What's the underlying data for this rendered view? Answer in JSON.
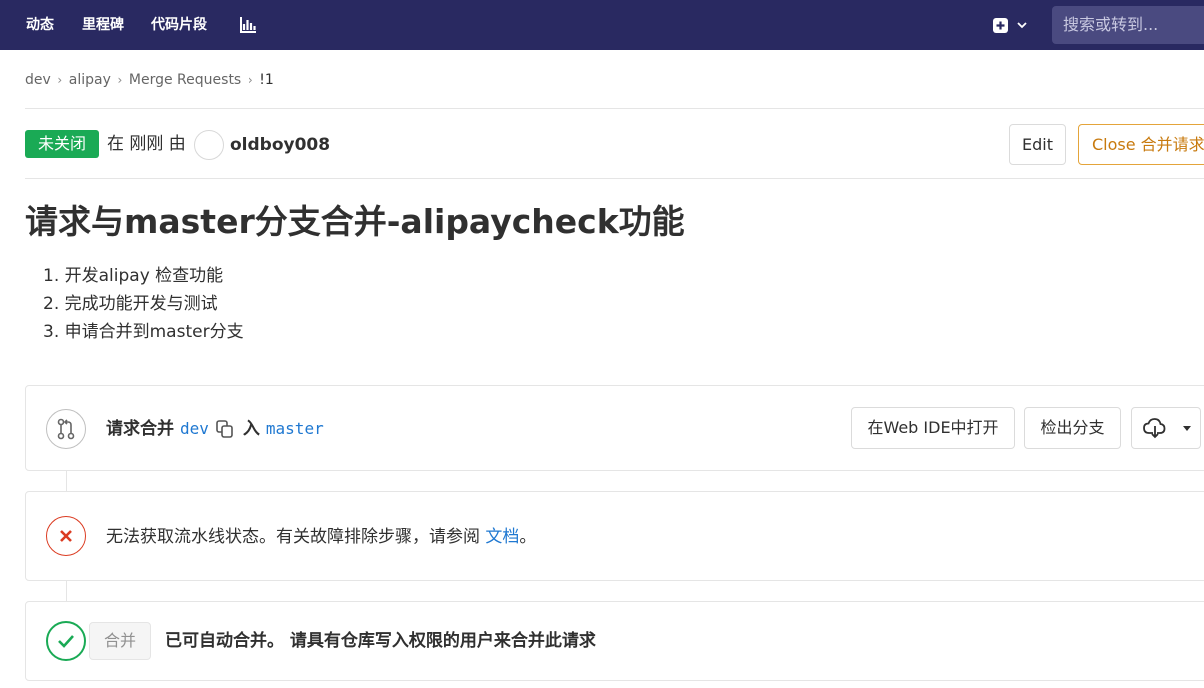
{
  "nav": {
    "items": [
      "动态",
      "里程碑",
      "代码片段"
    ],
    "chart_icon": "chart-icon",
    "plus_icon": "plus-square-icon",
    "search_placeholder": "搜索或转到..."
  },
  "breadcrumb": [
    "dev",
    "alipay",
    "Merge Requests",
    "!1"
  ],
  "status": {
    "badge": "未关闭",
    "meta": "在 刚刚 由",
    "author": "oldboy008"
  },
  "actions": {
    "edit": "Edit",
    "close": "Close 合并请求"
  },
  "mr": {
    "title": "请求与master分支合并-alipaycheck功能",
    "description": [
      "1. 开发alipay 检查功能",
      "2. 完成功能开发与测试",
      "3. 申请合并到master分支"
    ]
  },
  "branch_widget": {
    "prefix": "请求合并",
    "source": "dev",
    "into": "入",
    "target": "master",
    "webide": "在Web IDE中打开",
    "checkout": "检出分支"
  },
  "pipeline_widget": {
    "text": "无法获取流水线状态。有关故障排除步骤，请参阅",
    "link": "文档",
    "end": "。"
  },
  "merge_widget": {
    "button": "合并",
    "text": "已可自动合并。 请具有仓库写入权限的用户来合并此请求"
  },
  "colors": {
    "navbar": "#292961",
    "open_badge": "#1aaa55",
    "link": "#1f78d1",
    "close_button": "#e4a43a",
    "error": "#db3b21"
  }
}
